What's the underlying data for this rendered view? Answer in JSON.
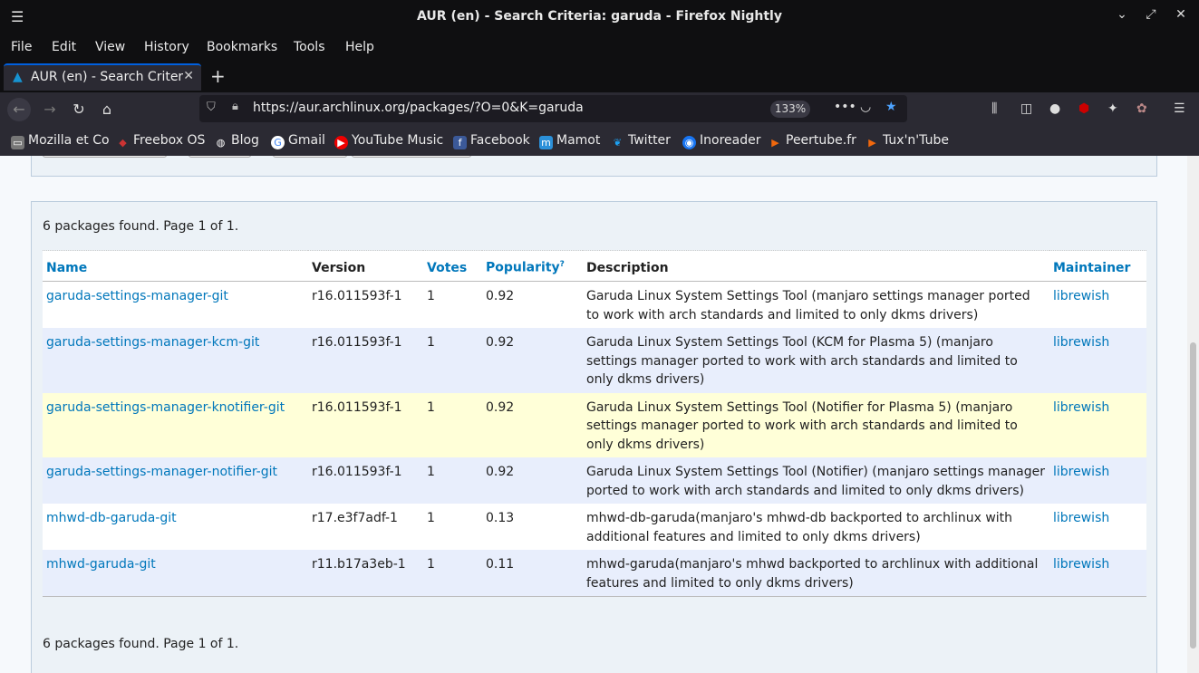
{
  "window": {
    "title": "AUR (en) - Search Criteria: garuda - Firefox Nightly"
  },
  "menu": [
    "File",
    "Edit",
    "View",
    "History",
    "Bookmarks",
    "Tools",
    "Help"
  ],
  "tab": {
    "label": "AUR (en) - Search Criteria: garuda"
  },
  "nav": {
    "url": "https://aur.archlinux.org/packages/?O=0&K=garuda",
    "zoom": "133%"
  },
  "bookmarks": [
    {
      "label": "Mozilla et Co",
      "icon": "folder-icon"
    },
    {
      "label": "Freebox OS",
      "icon": "freebox-icon"
    },
    {
      "label": "Blog",
      "icon": "globe-icon"
    },
    {
      "label": "Gmail",
      "icon": "google-icon"
    },
    {
      "label": "YouTube Music",
      "icon": "youtube-music-icon"
    },
    {
      "label": "Facebook",
      "icon": "facebook-icon"
    },
    {
      "label": "Mamot",
      "icon": "mastodon-icon"
    },
    {
      "label": "Twitter",
      "icon": "twitter-icon"
    },
    {
      "label": "Inoreader",
      "icon": "inoreader-icon"
    },
    {
      "label": "Peertube.fr",
      "icon": "peertube-icon"
    },
    {
      "label": "Tux'n'Tube",
      "icon": "peertube-icon"
    }
  ],
  "results": {
    "summary_top": "6 packages found. Page 1 of 1.",
    "summary_bottom": "6 packages found. Page 1 of 1.",
    "headers": {
      "name": "Name",
      "version": "Version",
      "votes": "Votes",
      "popularity": "Popularity",
      "popularity_sup": "?",
      "description": "Description",
      "maintainer": "Maintainer"
    },
    "rows": [
      {
        "name": "garuda-settings-manager-git",
        "version": "r16.011593f-1",
        "votes": "1",
        "popularity": "0.92",
        "description": "Garuda Linux System Settings Tool (manjaro settings manager ported to work with arch standards and limited to only dkms drivers)",
        "maintainer": "librewish"
      },
      {
        "name": "garuda-settings-manager-kcm-git",
        "version": "r16.011593f-1",
        "votes": "1",
        "popularity": "0.92",
        "description": "Garuda Linux System Settings Tool (KCM for Plasma 5) (manjaro settings manager ported to work with arch standards and limited to only dkms drivers)",
        "maintainer": "librewish"
      },
      {
        "name": "garuda-settings-manager-knotifier-git",
        "version": "r16.011593f-1",
        "votes": "1",
        "popularity": "0.92",
        "description": "Garuda Linux System Settings Tool (Notifier for Plasma 5) (manjaro settings manager ported to work with arch standards and limited to only dkms drivers)",
        "maintainer": "librewish"
      },
      {
        "name": "garuda-settings-manager-notifier-git",
        "version": "r16.011593f-1",
        "votes": "1",
        "popularity": "0.92",
        "description": "Garuda Linux System Settings Tool (Notifier) (manjaro settings manager ported to work with arch standards and limited to only dkms drivers)",
        "maintainer": "librewish"
      },
      {
        "name": "mhwd-db-garuda-git",
        "version": "r17.e3f7adf-1",
        "votes": "1",
        "popularity": "0.13",
        "description": "mhwd-db-garuda(manjaro's mhwd-db backported to archlinux with additional features and limited to only dkms drivers)",
        "maintainer": "librewish"
      },
      {
        "name": "mhwd-garuda-git",
        "version": "r11.b17a3eb-1",
        "votes": "1",
        "popularity": "0.11",
        "description": "mhwd-garuda(manjaro's mhwd backported to archlinux with additional features and limited to only dkms drivers)",
        "maintainer": "librewish"
      }
    ]
  },
  "colors": {
    "link": "#0077bb",
    "accent": "#0060df",
    "highlight_row": "#ffffd8"
  }
}
